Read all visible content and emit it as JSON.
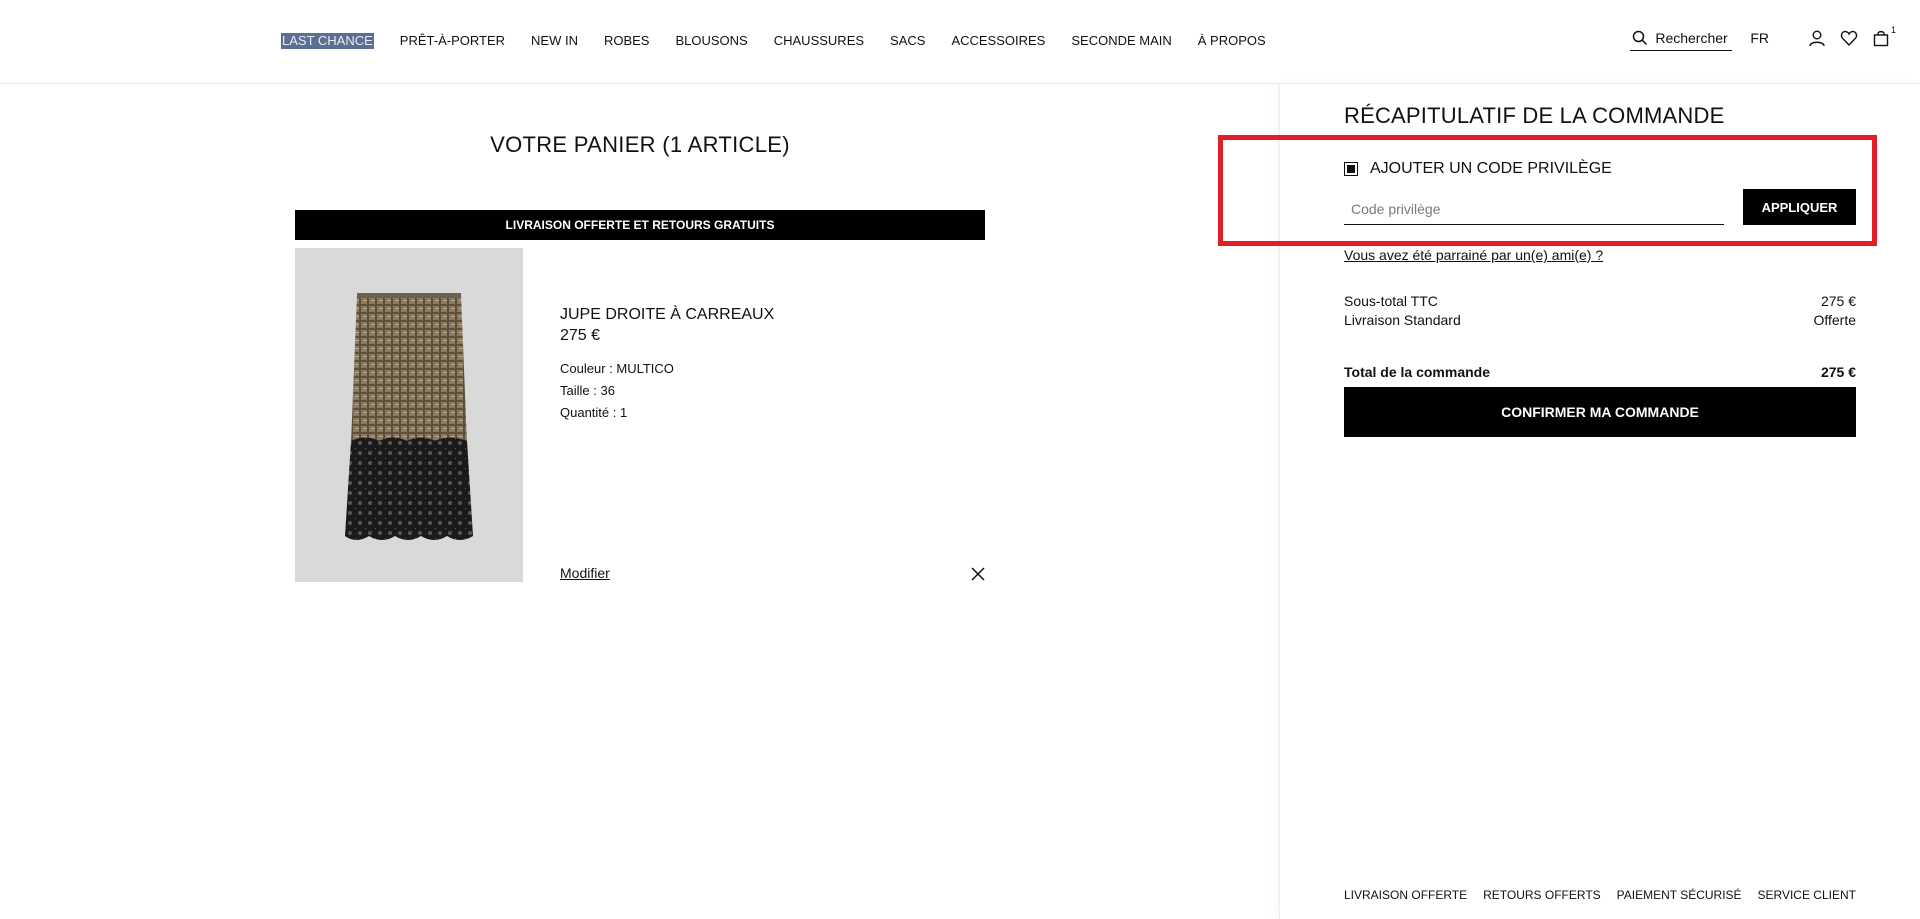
{
  "nav": {
    "items": [
      "LAST CHANCE",
      "PRÊT-À-PORTER",
      "NEW IN",
      "ROBES",
      "BLOUSONS",
      "CHAUSSURES",
      "SACS",
      "ACCESSOIRES",
      "SECONDE MAIN",
      "À PROPOS"
    ]
  },
  "header": {
    "search_label": "Rechercher",
    "lang": "FR",
    "cart_count": "1",
    "icons": [
      "search-icon",
      "account-icon",
      "heart-icon",
      "bag-icon"
    ]
  },
  "cart": {
    "title": "VOTRE PANIER (1 ARTICLE)",
    "banner": "LIVRAISON OFFERTE ET RETOURS GRATUITS",
    "item": {
      "name": "JUPE DROITE À CARREAUX",
      "price": "275 €",
      "color": "Couleur : MULTICO",
      "size": "Taille : 36",
      "quantity": "Quantité : 1",
      "modify_label": "Modifier"
    }
  },
  "summary": {
    "title": "RÉCAPITULATIF DE LA COMMANDE",
    "promo_label": "AJOUTER UN CODE PRIVILÈGE",
    "promo_placeholder": "Code privilège",
    "apply_label": "APPLIQUER",
    "referral_label": "Vous avez été parrainé par un(e) ami(e) ?",
    "subtotal_label": "Sous-total TTC",
    "subtotal_value": "275 €",
    "shipping_label": "Livraison Standard",
    "shipping_value": "Offerte",
    "total_label": "Total de la commande",
    "total_value": "275 €",
    "confirm_label": "CONFIRMER MA COMMANDE"
  },
  "footer": {
    "items": [
      "LIVRAISON OFFERTE",
      "RETOURS OFFERTS",
      "PAIEMENT SÉCURISÉ",
      "SERVICE CLIENT"
    ]
  },
  "colors": {
    "highlight_box": "#e41e26",
    "button_bg": "#000000",
    "nav_selection": "#5b6f93"
  }
}
